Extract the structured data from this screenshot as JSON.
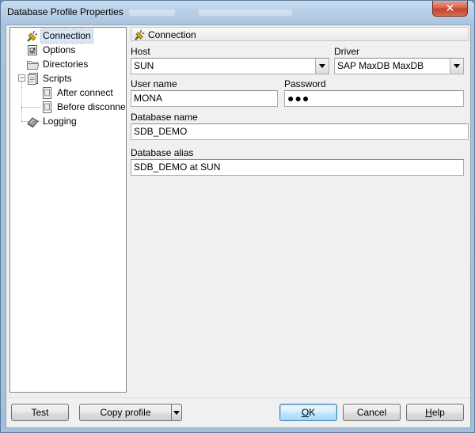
{
  "window": {
    "title": "Database Profile Properties",
    "close_glyph": "✕"
  },
  "tree": {
    "items": [
      {
        "label": "Connection",
        "icon": "connection-plug-icon"
      },
      {
        "label": "Options",
        "icon": "options-checkbox-icon"
      },
      {
        "label": "Directories",
        "icon": "folder-icon"
      },
      {
        "label": "Scripts",
        "icon": "scripts-icon"
      },
      {
        "label": "After connect",
        "icon": "script-page-icon"
      },
      {
        "label": "Before disconnect",
        "icon": "script-page-icon"
      },
      {
        "label": "Logging",
        "icon": "logging-book-icon"
      }
    ],
    "selected": "Connection"
  },
  "panel": {
    "header": "Connection",
    "host": {
      "label": "Host",
      "value": "SUN"
    },
    "driver": {
      "label": "Driver",
      "value": "SAP MaxDB MaxDB"
    },
    "user_name": {
      "label": "User name",
      "value": "MONA"
    },
    "password": {
      "label": "Password",
      "value": "●●●"
    },
    "database_name": {
      "label": "Database name",
      "value": "SDB_DEMO"
    },
    "database_alias": {
      "label": "Database alias",
      "value": "SDB_DEMO at SUN"
    }
  },
  "buttons": {
    "test": "Test",
    "copy_profile": "Copy profile",
    "ok_mnemonic": "O",
    "ok_rest": "K",
    "cancel": "Cancel",
    "help_mnemonic": "H",
    "help_rest": "elp"
  },
  "colors": {
    "accent_selection": "#d8e6f6",
    "title_bar": "#b8cfe6",
    "close_button": "#c3442a"
  }
}
